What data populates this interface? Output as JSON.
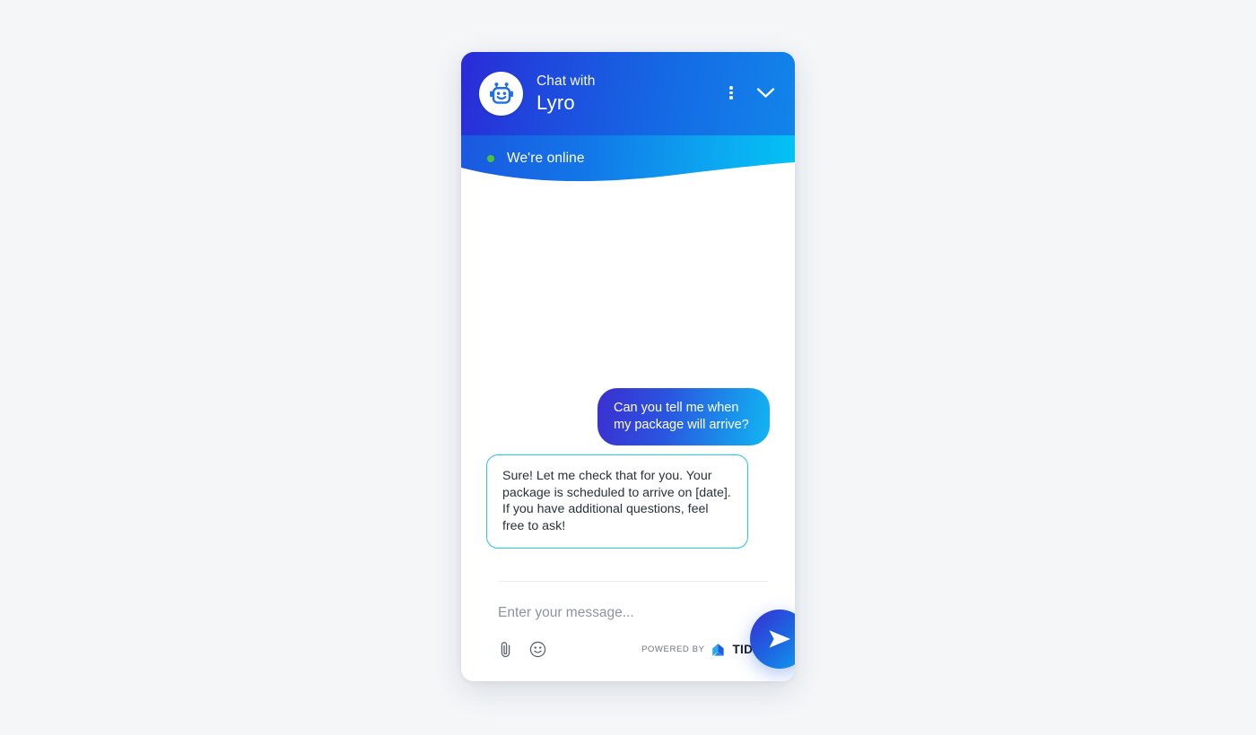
{
  "page": {
    "background_color": "#f4f6f8"
  },
  "widget": {
    "header": {
      "avatar_icon": "robot-avatar-icon",
      "title_small": "Chat with",
      "title_large": "Lyro",
      "menu_icon": "kebab-menu-icon",
      "collapse_icon": "chevron-down-icon",
      "status_text": "We're online",
      "status_color": "#4ec13b",
      "gradient_start": "#2a2ad6",
      "gradient_end": "#03c2f4"
    },
    "messages": [
      {
        "sender": "user",
        "text": "Can you tell me when my package will arrive?"
      },
      {
        "sender": "bot",
        "text": "Sure! Let me check that for you. Your package is scheduled to arrive on [date]. If you have additional questions, feel free to ask!"
      }
    ],
    "composer": {
      "placeholder": "Enter your message...",
      "value": "",
      "attach_icon": "paperclip-icon",
      "emoji_icon": "smiley-face-icon",
      "send_icon": "send-plane-icon",
      "powered_by_label": "POWERED BY",
      "brand_name": "TIDIO",
      "brand_logo_icon": "tidio-logo-icon"
    }
  }
}
